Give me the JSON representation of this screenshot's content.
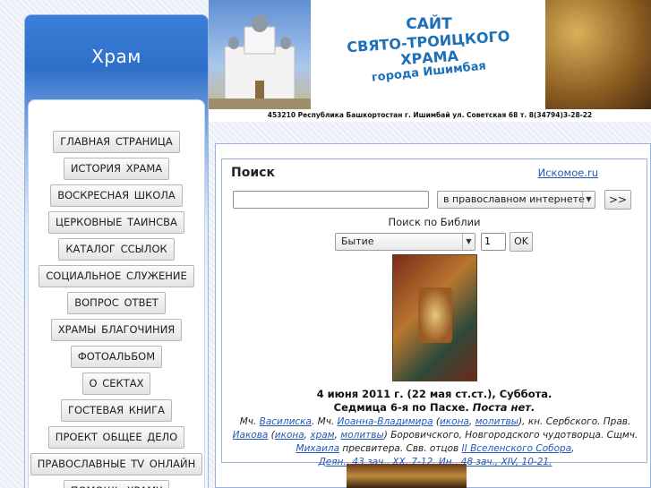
{
  "sidebar": {
    "title": "Храм",
    "menu": [
      "Главная страница",
      "История храма",
      "Воскресная школа",
      "Церковные таинсва",
      "Каталог ссылок",
      "Социальное служение",
      "Вопрос ответ",
      "Храмы благочиния",
      "Фотоальбом",
      "О сектах",
      "Гостевая книга",
      "Проект общее дело",
      "Православные TV онлайн",
      "Помощь храму"
    ]
  },
  "header": {
    "title_line1": "САЙТ",
    "title_line2": "СВЯТО-ТРОИЦКОГО ХРАМА",
    "title_line3": "города Ишимбая",
    "address": "453210 Республика Башкортостан г. Ишимбай ул. Советская 68 т. 8(34794)3-28-22"
  },
  "search": {
    "title": "Поиск",
    "provider_link": "Искомое.ru",
    "query_value": "",
    "scope_selected": "в православном интернете",
    "go_label": ">>",
    "bible_label": "Поиск по Библии",
    "book_selected": "Бытие",
    "chapter_value": "1",
    "ok_label": "OK"
  },
  "calendar": {
    "date": "4 июня 2011 г. (22 мая ст.ст.), Суббота.",
    "week": "Седмица 6-я по Пасхе.",
    "fast": "Поста нет.",
    "t1": "Мч. ",
    "l1": "Василиска",
    "t2": ". Мч. ",
    "l2": "Иоанна-Владимира",
    "t3": " (",
    "l3": "икона",
    "t4": ", ",
    "l4": "молитвы",
    "t5": "), кн. Сербского. Прав. ",
    "l5": "Иакова",
    "t6": " (",
    "l6": "икона",
    "t7": ", ",
    "l7": "храм",
    "t8": ", ",
    "l8": "молитвы",
    "t9": ") Боровичского, Новгородского чудотворца. Сщмч. ",
    "l9": "Михаила",
    "t10": " пресвитера. Свв. отцов ",
    "l10": "II Вселенского Собора",
    "t11": ",",
    "l11": "Деян., 43 зач., XX, 7-12. Ин., 48 зач., XIV, 10-21."
  }
}
